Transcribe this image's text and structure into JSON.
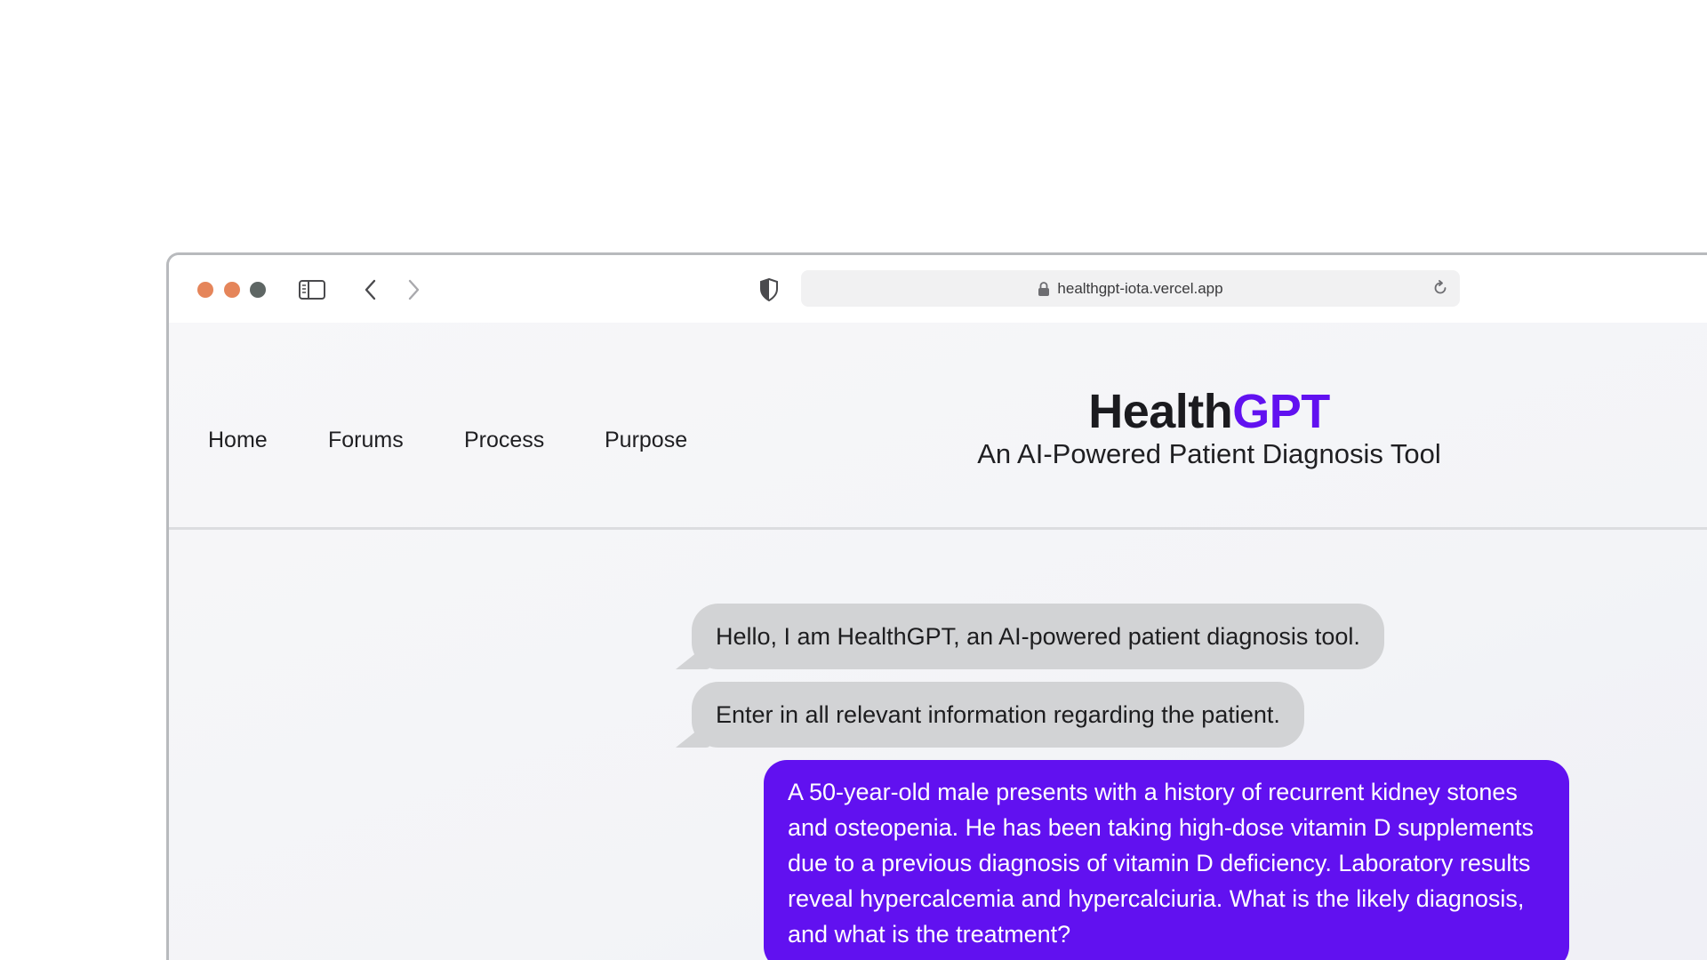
{
  "browser": {
    "url": "healthgpt-iota.vercel.app",
    "colors": {
      "close": "#e5855a",
      "minimize": "#e5855a",
      "zoom": "#5e6664"
    },
    "icons": {
      "sidebar": "sidebar-icon",
      "back": "chevron-left-icon",
      "forward": "chevron-right-icon",
      "privacy": "shield-icon",
      "lock": "lock-icon",
      "reload": "reload-icon"
    }
  },
  "nav": {
    "items": [
      {
        "label": "Home"
      },
      {
        "label": "Forums"
      },
      {
        "label": "Process"
      },
      {
        "label": "Purpose"
      }
    ]
  },
  "header": {
    "title_part1": "Health",
    "title_part2": "GPT",
    "subtitle": "An AI-Powered Patient Diagnosis Tool",
    "accent_color": "#6111f0"
  },
  "chat": {
    "messages": [
      {
        "role": "bot",
        "text": "Hello, I am HealthGPT, an AI-powered patient diagnosis tool."
      },
      {
        "role": "bot",
        "text": "Enter in all relevant information regarding the patient."
      },
      {
        "role": "user",
        "text": "A 50-year-old male presents with a history of recurrent kidney stones and osteopenia. He has been taking high-dose vitamin D supplements due to a previous diagnosis of vitamin D deficiency. Laboratory results reveal hypercalcemia and hypercalciuria. What is the likely diagnosis, and what is the treatment?"
      }
    ]
  }
}
